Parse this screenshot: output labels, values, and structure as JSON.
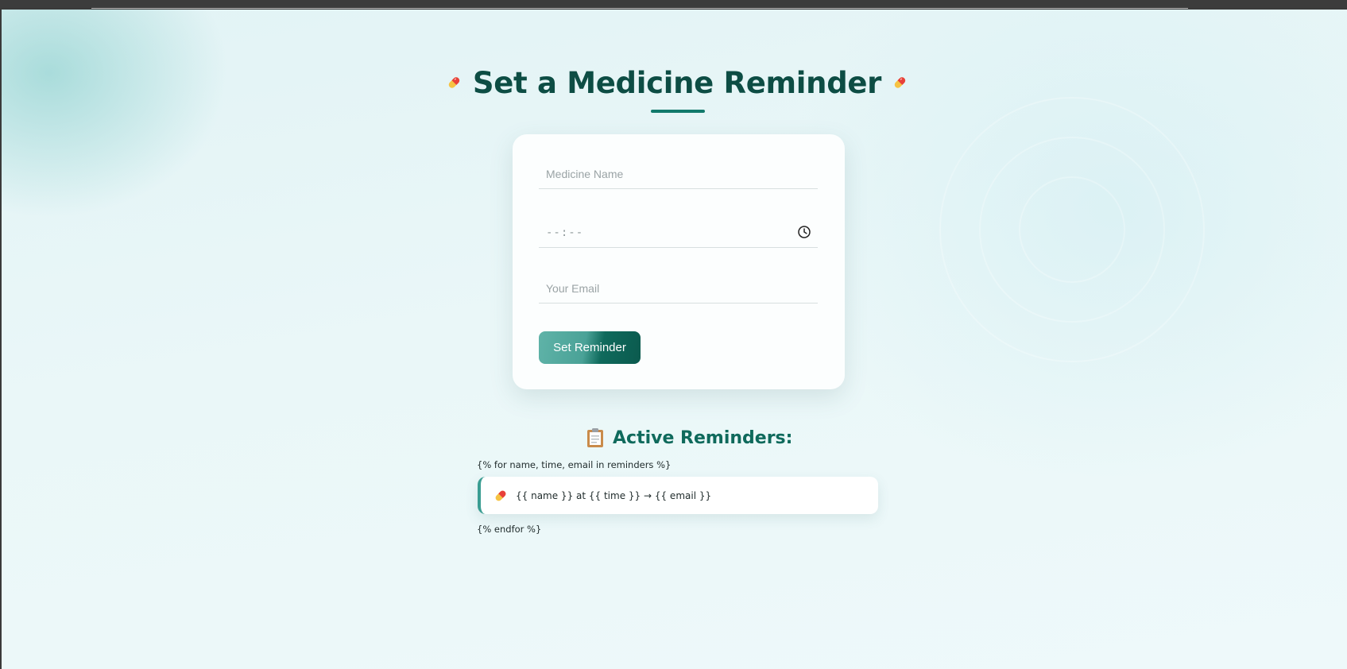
{
  "page": {
    "title": "Set a Medicine Reminder",
    "title_icon": "pill-icon"
  },
  "form": {
    "medicine_name_placeholder": "Medicine Name",
    "time_placeholder": "--:--",
    "time_icon": "clock-icon",
    "email_placeholder": "Your Email",
    "submit_label": "Set Reminder"
  },
  "reminders": {
    "heading": "Active Reminders:",
    "heading_icon": "clipboard-icon",
    "loop_start": "{% for name, time, email in reminders %}",
    "item_text": "{{ name }} at {{ time }} → {{ email }}",
    "item_icon": "pill-icon",
    "loop_end": "{% endfor %}"
  },
  "colors": {
    "title": "#0d4d44",
    "accent": "#127a6c",
    "button_start": "#5fb3a8",
    "button_end": "#0b5a4e",
    "background": "#e6f5f6"
  }
}
